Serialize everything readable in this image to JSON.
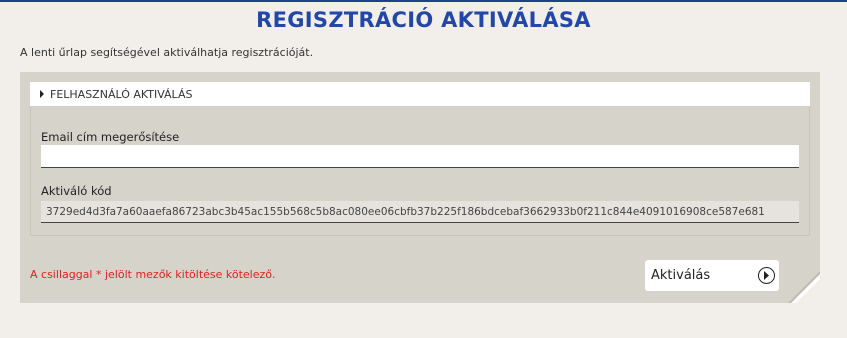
{
  "page": {
    "title": "REGISZTRÁCIÓ AKTIVÁLÁSA",
    "intro": "A lenti űrlap segítségével aktiválhatja regisztrációját."
  },
  "section": {
    "title": "FELHASZNÁLÓ AKTIVÁLÁS"
  },
  "form": {
    "email_label": "Email cím megerősítése",
    "email_value": "",
    "code_label": "Aktiváló kód",
    "code_value": "3729ed4d3fa7a60aaefa86723abc3b45ac155b568c5b8ac080ee06cbfb37b225f186bdcebaf3662933b0f211c844e4091016908ce587e681"
  },
  "footer": {
    "required_note": "A csillaggal * jelölt mezők kitöltése kötelező.",
    "submit_label": "Aktiválás"
  },
  "colors": {
    "title": "#2347a8",
    "panel": "#d6d3cb",
    "required": "#e02020",
    "background": "#f2efea"
  },
  "icons": {
    "section_toggle": "triangle-right-icon",
    "submit": "circle-chevron-right-icon"
  }
}
